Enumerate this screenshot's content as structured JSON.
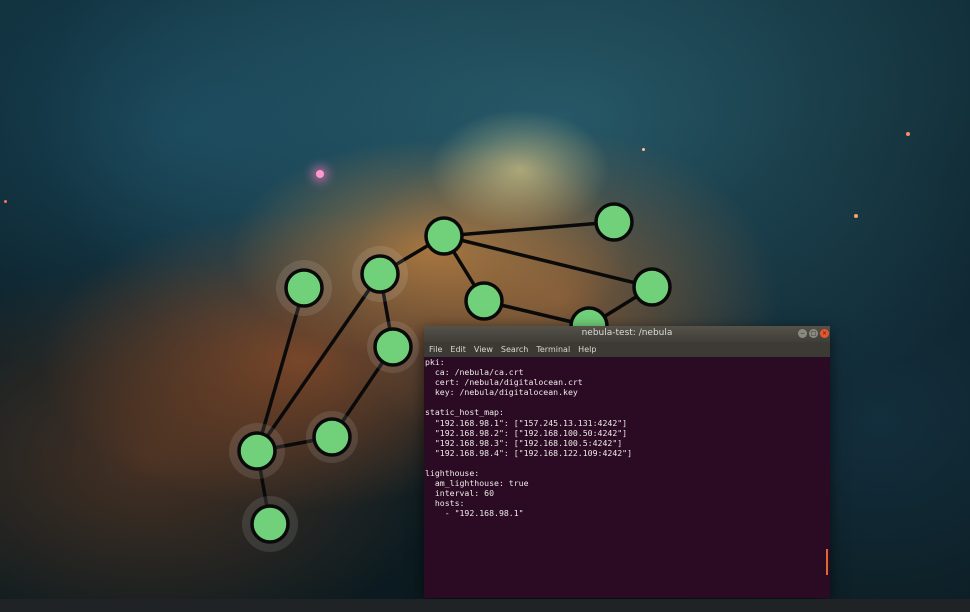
{
  "terminal": {
    "title": "nebula-test: /nebula",
    "window_buttons": {
      "minimize": "−",
      "maximize": "□",
      "close": "×"
    },
    "menu": [
      "File",
      "Edit",
      "View",
      "Search",
      "Terminal",
      "Help"
    ],
    "lines": [
      "pki:",
      "  ca: /nebula/ca.crt",
      "  cert: /nebula/digitalocean.crt",
      "  key: /nebula/digitalocean.key",
      "",
      "static_host_map:",
      "  \"192.168.98.1\": [\"157.245.13.131:4242\"]",
      "  \"192.168.98.2\": [\"192.168.100.50:4242\"]",
      "  \"192.168.98.3\": [\"192.168.100.5:4242\"]",
      "  \"192.168.98.4\": [\"192.168.122.109:4242\"]",
      "",
      "lighthouse:",
      "  am_lighthouse: true",
      "  interval: 60",
      "  hosts:",
      "    - \"192.168.98.1\""
    ],
    "colors": {
      "background": "#2b0a23",
      "text": "#ecebe6",
      "titlebar": "#3f3d37",
      "close_button": "#e5572d",
      "scroll_thumb": "#e2672c"
    }
  },
  "network_graph": {
    "node_color": "#71d17a",
    "edge_color": "#0a0a0a",
    "node_count": 11,
    "edge_count": 12
  }
}
